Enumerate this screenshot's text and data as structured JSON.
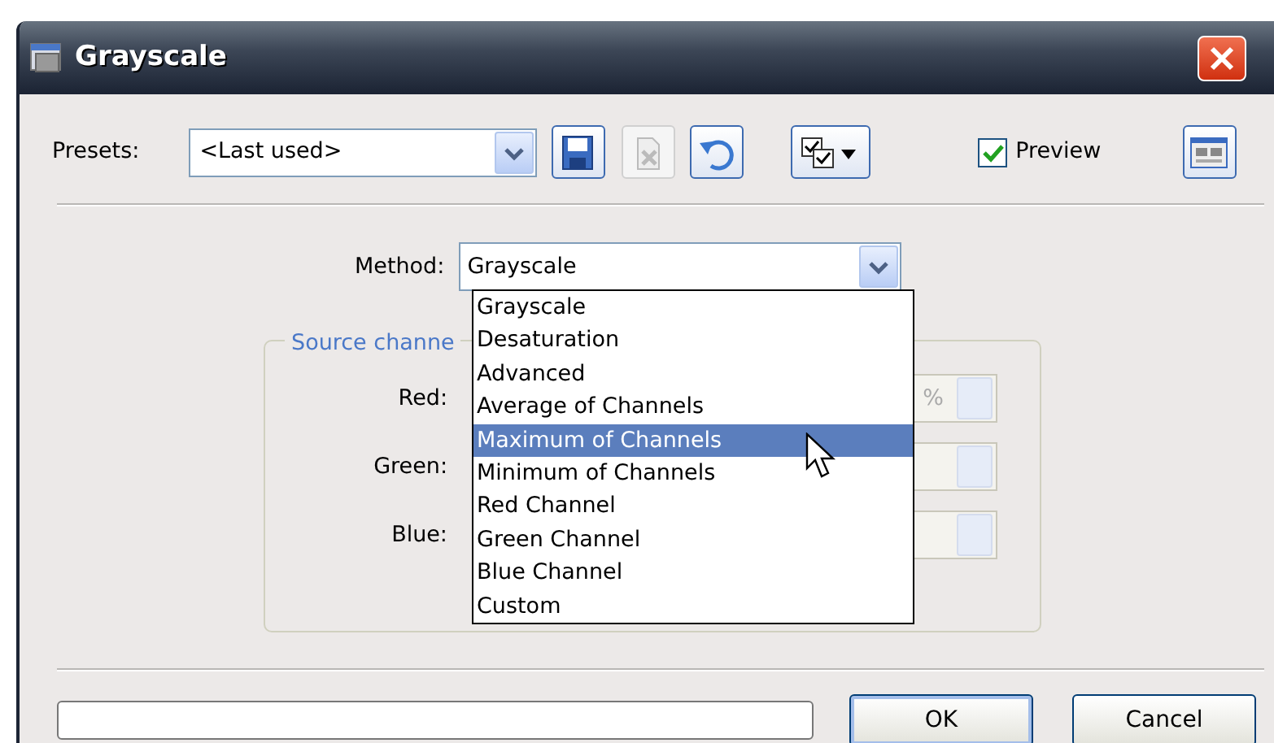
{
  "window": {
    "title": "Grayscale"
  },
  "presets": {
    "label": "Presets:",
    "value": "<Last used>"
  },
  "preview": {
    "label": "Preview",
    "checked": true
  },
  "method": {
    "label": "Method:",
    "value": "Grayscale",
    "expanded": true,
    "options": [
      {
        "label": "Grayscale",
        "highlighted": false
      },
      {
        "label": "Desaturation",
        "highlighted": false
      },
      {
        "label": "Advanced",
        "highlighted": false
      },
      {
        "label": "Average of Channels",
        "highlighted": false
      },
      {
        "label": "Maximum of Channels",
        "highlighted": true
      },
      {
        "label": "Minimum of Channels",
        "highlighted": false
      },
      {
        "label": "Red Channel",
        "highlighted": false
      },
      {
        "label": "Green Channel",
        "highlighted": false
      },
      {
        "label": "Blue Channel",
        "highlighted": false
      },
      {
        "label": "Custom",
        "highlighted": false
      }
    ]
  },
  "source_channels": {
    "title": "Source channe",
    "rows": [
      {
        "label": "Red:",
        "unit": "%"
      },
      {
        "label": "Green:"
      },
      {
        "label": "Blue:"
      }
    ]
  },
  "progress": {
    "level": 0
  },
  "buttons": [
    "OK",
    "Cancel"
  ]
}
